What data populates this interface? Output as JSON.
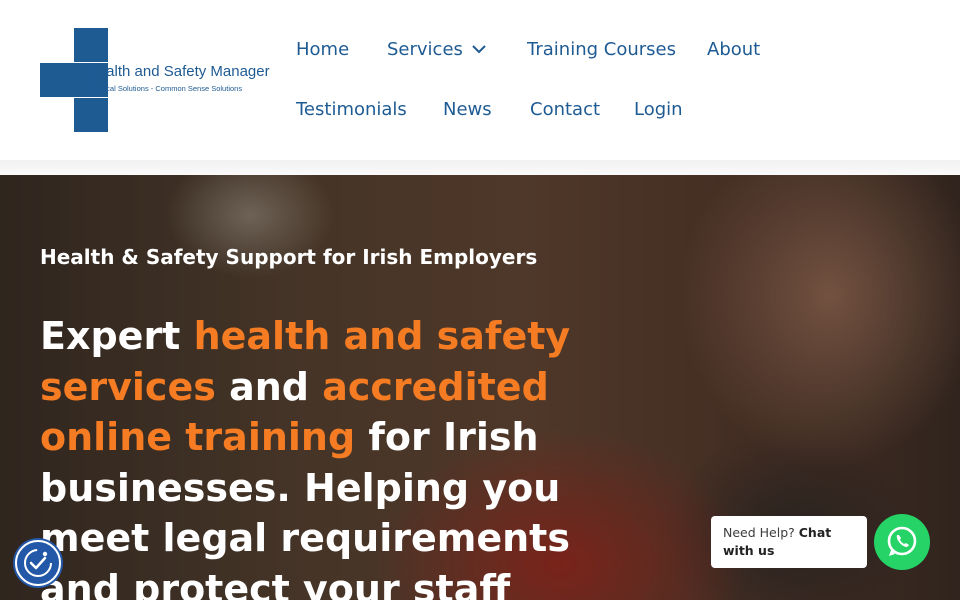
{
  "logo": {
    "title": "Health and Safety Manager",
    "tagline": "Practical Solutions - Common Sense Solutions",
    "brand_color": "#1f5b93"
  },
  "nav": {
    "items": [
      {
        "label": "Home"
      },
      {
        "label": "Services",
        "icon": "chevron-down-icon"
      },
      {
        "label": "Training Courses"
      },
      {
        "label": "About"
      },
      {
        "label": "Testimonials"
      },
      {
        "label": "News"
      },
      {
        "label": "Contact"
      },
      {
        "label": "Login"
      }
    ],
    "color": "#1f5b93"
  },
  "hero": {
    "subheading": "Health & Safety Support for Irish Employers",
    "heading_parts": [
      {
        "text": "Expert ",
        "highlight": false
      },
      {
        "text": "health and safety services",
        "highlight": true
      },
      {
        "text": " and ",
        "highlight": false
      },
      {
        "text": "accredited online training",
        "highlight": true
      },
      {
        "text": " for Irish businesses. Helping you meet legal requirements and protect your staff",
        "highlight": false
      }
    ],
    "highlight_color": "#f57c22"
  },
  "accessibility": {
    "icon": "accessibility-icon"
  },
  "chat": {
    "prefix": "Need Help?",
    "cta": "Chat with us",
    "icon": "whatsapp-icon",
    "color": "#25d366"
  }
}
